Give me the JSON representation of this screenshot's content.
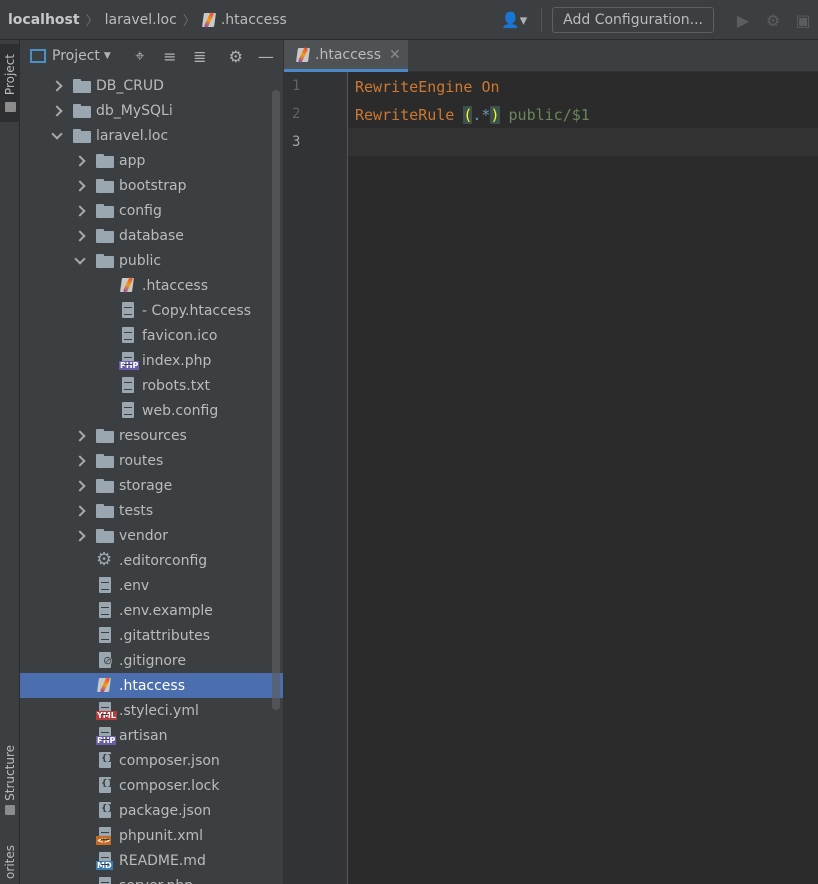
{
  "breadcrumbs": [
    "localhost",
    "laravel.loc",
    ".htaccess"
  ],
  "toolbar": {
    "add_config_label": "Add Configuration..."
  },
  "left_strip": {
    "project_label": "Project",
    "structure_label": "Structure",
    "favorites_label": "orites"
  },
  "project_panel": {
    "title": "Project"
  },
  "tree": [
    {
      "label": "DB_CRUD",
      "kind": "folder",
      "depth": 1,
      "arrow": "closed"
    },
    {
      "label": "db_MySQLi",
      "kind": "folder",
      "depth": 1,
      "arrow": "closed"
    },
    {
      "label": "laravel.loc",
      "kind": "folder",
      "depth": 1,
      "arrow": "open"
    },
    {
      "label": "app",
      "kind": "folder",
      "depth": 2,
      "arrow": "closed"
    },
    {
      "label": "bootstrap",
      "kind": "folder",
      "depth": 2,
      "arrow": "closed"
    },
    {
      "label": "config",
      "kind": "folder",
      "depth": 2,
      "arrow": "closed"
    },
    {
      "label": "database",
      "kind": "folder",
      "depth": 2,
      "arrow": "closed"
    },
    {
      "label": "public",
      "kind": "folder",
      "depth": 2,
      "arrow": "open"
    },
    {
      "label": ".htaccess",
      "kind": "htaccess",
      "depth": 3
    },
    {
      "label": "- Copy.htaccess",
      "kind": "doc",
      "depth": 3
    },
    {
      "label": "favicon.ico",
      "kind": "ico",
      "depth": 3
    },
    {
      "label": "index.php",
      "kind": "php",
      "depth": 3
    },
    {
      "label": "robots.txt",
      "kind": "doc",
      "depth": 3
    },
    {
      "label": "web.config",
      "kind": "doc",
      "depth": 3
    },
    {
      "label": "resources",
      "kind": "folder",
      "depth": 2,
      "arrow": "closed"
    },
    {
      "label": "routes",
      "kind": "folder",
      "depth": 2,
      "arrow": "closed"
    },
    {
      "label": "storage",
      "kind": "folder",
      "depth": 2,
      "arrow": "closed"
    },
    {
      "label": "tests",
      "kind": "folder",
      "depth": 2,
      "arrow": "closed"
    },
    {
      "label": "vendor",
      "kind": "folder",
      "depth": 2,
      "arrow": "closed"
    },
    {
      "label": ".editorconfig",
      "kind": "gear",
      "depth": 2
    },
    {
      "label": ".env",
      "kind": "doc",
      "depth": 2
    },
    {
      "label": ".env.example",
      "kind": "doc",
      "depth": 2
    },
    {
      "label": ".gitattributes",
      "kind": "doc",
      "depth": 2
    },
    {
      "label": ".gitignore",
      "kind": "ignore",
      "depth": 2
    },
    {
      "label": ".htaccess",
      "kind": "htaccess",
      "depth": 2,
      "selected": true
    },
    {
      "label": ".styleci.yml",
      "kind": "yml",
      "depth": 2
    },
    {
      "label": "artisan",
      "kind": "php",
      "depth": 2
    },
    {
      "label": "composer.json",
      "kind": "json",
      "depth": 2
    },
    {
      "label": "composer.lock",
      "kind": "json",
      "depth": 2
    },
    {
      "label": "package.json",
      "kind": "json",
      "depth": 2
    },
    {
      "label": "phpunit.xml",
      "kind": "xml",
      "depth": 2
    },
    {
      "label": "README.md",
      "kind": "md",
      "depth": 2
    },
    {
      "label": "server.php",
      "kind": "php",
      "depth": 2
    }
  ],
  "badges": {
    "php": "PHP",
    "yml": "YML",
    "md": "MD",
    "xml": "<>",
    "ico": ""
  },
  "editor": {
    "tab_label": ".htaccess",
    "lines": [
      {
        "n": "1",
        "parts": [
          {
            "t": "RewriteEngine",
            "c": "kw"
          },
          {
            "t": " "
          },
          {
            "t": "On",
            "c": "kw"
          }
        ]
      },
      {
        "n": "2",
        "parts": [
          {
            "t": "RewriteRule",
            "c": "kw"
          },
          {
            "t": " "
          },
          {
            "t": "(",
            "c": "paren"
          },
          {
            "t": ".*",
            "c": "rx"
          },
          {
            "t": ")",
            "c": "paren"
          },
          {
            "t": " public/$1",
            "c": "val"
          }
        ]
      },
      {
        "n": "3",
        "parts": []
      }
    ]
  }
}
